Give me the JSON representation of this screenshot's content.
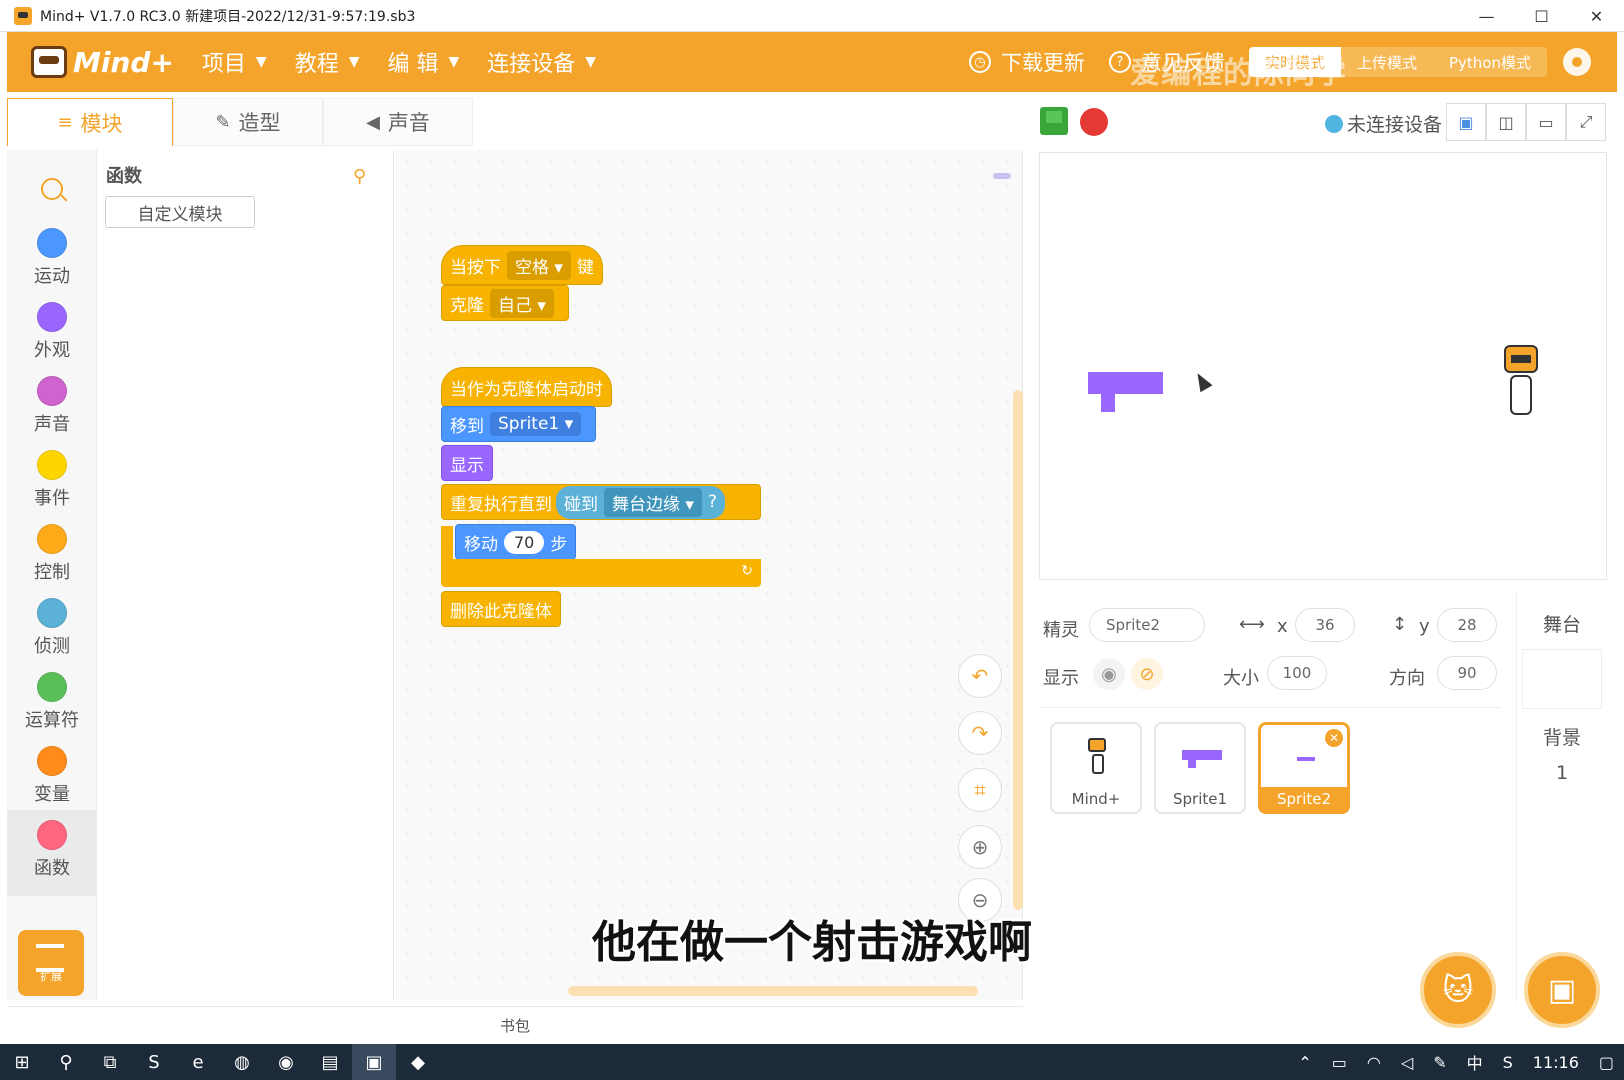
{
  "window": {
    "title": "Mind+ V1.7.0 RC3.0    新建项目-2022/12/31-9:57:19.sb3",
    "minimize": "—",
    "maximize": "☐",
    "close": "✕"
  },
  "menubar": {
    "logo": "Mind+",
    "items": [
      "项目",
      "教程",
      "编 辑",
      "连接设备"
    ],
    "caret": "▼",
    "update": "下载更新",
    "feedback": "意见反馈",
    "mode_realtime": "实时模式",
    "mode_upload": "上传模式",
    "mode_python": "Python模式",
    "watermark": "爱编程的陈同学"
  },
  "tabs": [
    {
      "label": "模块",
      "icon": "≡"
    },
    {
      "label": "造型",
      "icon": "✎"
    },
    {
      "label": "声音",
      "icon": "◀"
    }
  ],
  "stage_controls": {
    "connection": "未连接设备",
    "layout_icons": [
      "▣",
      "◫",
      "▭",
      "⤢"
    ]
  },
  "categories": [
    {
      "label": "运动",
      "color": "#4c97ff"
    },
    {
      "label": "外观",
      "color": "#9966ff"
    },
    {
      "label": "声音",
      "color": "#cf63cf"
    },
    {
      "label": "事件",
      "color": "#ffd500"
    },
    {
      "label": "控制",
      "color": "#ffab19"
    },
    {
      "label": "侦测",
      "color": "#5cb1d6"
    },
    {
      "label": "运算符",
      "color": "#59c059"
    },
    {
      "label": "变量",
      "color": "#ff8c1a"
    },
    {
      "label": "函数",
      "color": "#ff6680"
    }
  ],
  "extension_label": "扩展",
  "palette": {
    "title": "函数",
    "button": "自定义模块"
  },
  "script1": {
    "when_key": "当按下",
    "key": "空格",
    "key_suffix": "键",
    "clone": "克隆",
    "clone_target": "自己"
  },
  "script2": {
    "hat": "当作为克隆体启动时",
    "goto": "移到",
    "goto_target": "Sprite1",
    "show": "显示",
    "repeat_until": "重复执行直到",
    "touching": "碰到",
    "touching_target": "舞台边缘",
    "q": "?",
    "move": "移动",
    "steps": "70",
    "steps_suffix": "步",
    "delete_clone": "删除此克隆体"
  },
  "backpack": "书包",
  "sprite_info": {
    "sprite_label": "精灵",
    "sprite_name": "Sprite2",
    "x_label": "x",
    "x_value": "36",
    "y_label": "y",
    "y_value": "28",
    "show_label": "显示",
    "size_label": "大小",
    "size_value": "100",
    "direction_label": "方向",
    "direction_value": "90"
  },
  "sprites": [
    "Mind+",
    "Sprite1",
    "Sprite2"
  ],
  "stage_panel": {
    "title": "舞台",
    "backdrop_label": "背景",
    "backdrop_count": "1"
  },
  "subtitle": "他在做一个射击游戏啊",
  "taskbar": {
    "clock": "11:16",
    "ime": "中"
  }
}
